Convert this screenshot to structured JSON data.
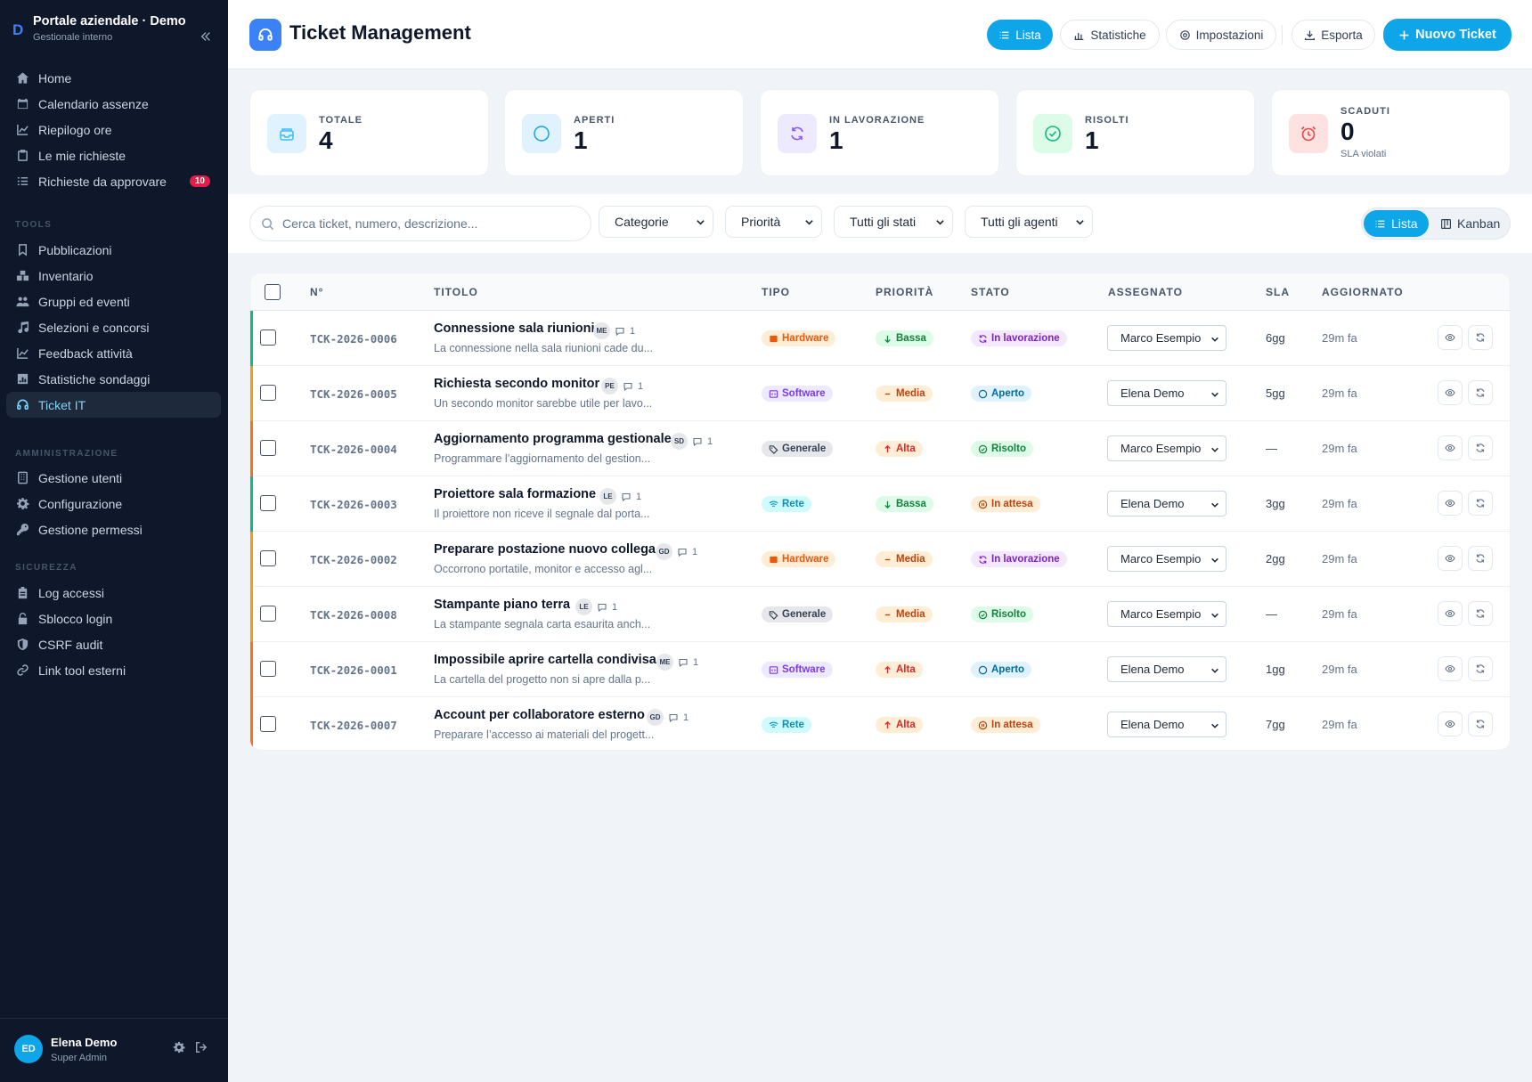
{
  "sidebar": {
    "logo": "D",
    "title": "Portale aziendale · Demo",
    "subtitle": "Gestionale interno",
    "items": [
      {
        "label": "Home"
      },
      {
        "label": "Calendario assenze"
      },
      {
        "label": "Riepilogo ore"
      },
      {
        "label": "Le mie richieste"
      },
      {
        "label": "Richieste da approvare",
        "badge": "10"
      }
    ],
    "sections": [
      {
        "title": "TOOLS",
        "items": [
          {
            "label": "Pubblicazioni"
          },
          {
            "label": "Inventario"
          },
          {
            "label": "Gruppi ed eventi"
          },
          {
            "label": "Selezioni e concorsi"
          },
          {
            "label": "Feedback attività"
          },
          {
            "label": "Statistiche sondaggi"
          },
          {
            "label": "Ticket IT"
          }
        ]
      },
      {
        "title": "AMMINISTRAZIONE",
        "items": [
          {
            "label": "Gestione utenti"
          },
          {
            "label": "Configurazione"
          },
          {
            "label": "Gestione permessi"
          }
        ]
      },
      {
        "title": "SICUREZZA",
        "items": [
          {
            "label": "Log accessi"
          },
          {
            "label": "Sblocco login"
          },
          {
            "label": "CSRF audit"
          },
          {
            "label": "Link tool esterni"
          }
        ]
      }
    ],
    "user": {
      "initials": "ED",
      "name": "Elena Demo",
      "role": "Super Admin"
    }
  },
  "header": {
    "title": "Ticket Management",
    "buttons": {
      "list": "Lista",
      "stats": "Statistiche",
      "settings": "Impostazioni",
      "export": "Esporta",
      "new": "Nuovo Ticket"
    }
  },
  "stats": [
    {
      "label": "TOTALE",
      "value": "4",
      "sub": ""
    },
    {
      "label": "APERTI",
      "value": "1",
      "sub": ""
    },
    {
      "label": "IN LAVORAZIONE",
      "value": "1",
      "sub": ""
    },
    {
      "label": "RISOLTI",
      "value": "1",
      "sub": ""
    },
    {
      "label": "SCADUTI",
      "value": "0",
      "sub": "SLA violati"
    }
  ],
  "filters": {
    "search_placeholder": "Cerca ticket, numero, descrizione...",
    "category": "Categorie",
    "priority": "Priorità",
    "status": "Tutti gli stati",
    "agent": "Tutti gli agenti",
    "view_list": "Lista",
    "view_kanban": "Kanban"
  },
  "table": {
    "columns": {
      "num": "N°",
      "title": "TITOLO",
      "type": "TIPO",
      "priority": "PRIORITÀ",
      "status": "STATO",
      "assigned": "ASSEGNATO",
      "sla": "SLA",
      "updated": "AGGIORNATO"
    },
    "rows": [
      {
        "num": "TCK-2026-0006",
        "title": "Connessione sala riunioni",
        "initials": "ME",
        "comments": "1",
        "desc": "La connessione nella sala riunioni cade du...",
        "type": "Hardware",
        "priority": "Bassa",
        "status": "In lavorazione",
        "assignee": "Marco Esempio",
        "sla": "6gg",
        "updated": "29m fa"
      },
      {
        "num": "TCK-2026-0005",
        "title": "Richiesta secondo monitor",
        "initials": "PE",
        "comments": "1",
        "desc": "Un secondo monitor sarebbe utile per lavo...",
        "type": "Software",
        "priority": "Media",
        "status": "Aperto",
        "assignee": "Elena Demo",
        "sla": "5gg",
        "updated": "29m fa"
      },
      {
        "num": "TCK-2026-0004",
        "title": "Aggiornamento programma gestionale",
        "initials": "SD",
        "comments": "1",
        "desc": "Programmare l’aggiornamento del gestion...",
        "type": "Generale",
        "priority": "Alta",
        "status": "Risolto",
        "assignee": "Marco Esempio",
        "sla": "—",
        "updated": "29m fa"
      },
      {
        "num": "TCK-2026-0003",
        "title": "Proiettore sala formazione",
        "initials": "LE",
        "comments": "1",
        "desc": "Il proiettore non riceve il segnale dal porta...",
        "type": "Rete",
        "priority": "Bassa",
        "status": "In attesa",
        "assignee": "Elena Demo",
        "sla": "3gg",
        "updated": "29m fa"
      },
      {
        "num": "TCK-2026-0002",
        "title": "Preparare postazione nuovo collega",
        "initials": "GD",
        "comments": "1",
        "desc": "Occorrono portatile, monitor e accesso agl...",
        "type": "Hardware",
        "priority": "Media",
        "status": "In lavorazione",
        "assignee": "Marco Esempio",
        "sla": "2gg",
        "updated": "29m fa"
      },
      {
        "num": "TCK-2026-0008",
        "title": "Stampante piano terra",
        "initials": "LE",
        "comments": "1",
        "desc": "La stampante segnala carta esaurita anch...",
        "type": "Generale",
        "priority": "Media",
        "status": "Risolto",
        "assignee": "Marco Esempio",
        "sla": "—",
        "updated": "29m fa"
      },
      {
        "num": "TCK-2026-0001",
        "title": "Impossibile aprire cartella condivisa",
        "initials": "ME",
        "comments": "1",
        "desc": "La cartella del progetto non si apre dalla p...",
        "type": "Software",
        "priority": "Alta",
        "status": "Aperto",
        "assignee": "Elena Demo",
        "sla": "1gg",
        "updated": "29m fa"
      },
      {
        "num": "TCK-2026-0007",
        "title": "Account per collaboratore esterno",
        "initials": "GD",
        "comments": "1",
        "desc": "Preparare l’accesso ai materiali del progett...",
        "type": "Rete",
        "priority": "Alta",
        "status": "In attesa",
        "assignee": "Elena Demo",
        "sla": "7gg",
        "updated": "29m fa"
      }
    ]
  },
  "colors": {
    "accent": "#0ea5e9",
    "sidebar_bg": "#0f172a",
    "priority_low": "#10b981",
    "priority_medium": "#f59e0b",
    "priority_high": "#f97316"
  }
}
